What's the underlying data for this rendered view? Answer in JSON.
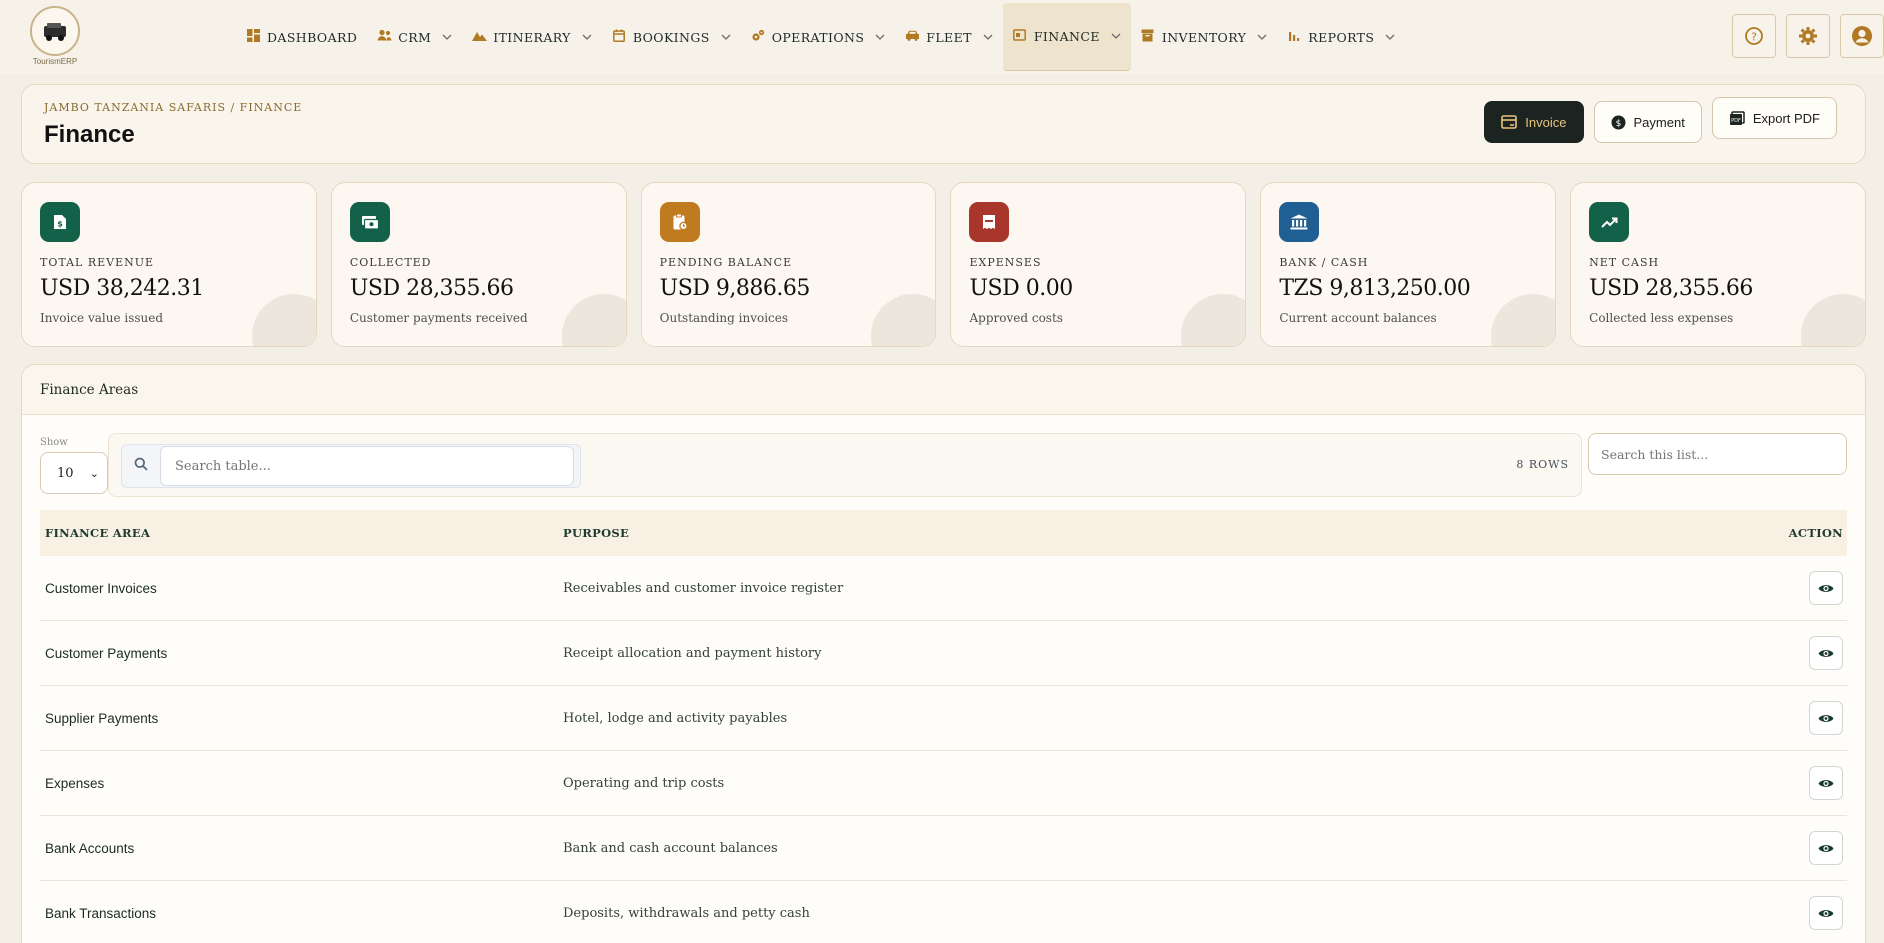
{
  "brand": {
    "name": "TourismERP"
  },
  "nav": [
    {
      "label": "DASHBOARD",
      "icon": "dashboard-icon",
      "dropdown": false,
      "active": false
    },
    {
      "label": "CRM",
      "icon": "users-icon",
      "dropdown": true,
      "active": false
    },
    {
      "label": "ITINERARY",
      "icon": "mountain-icon",
      "dropdown": true,
      "active": false
    },
    {
      "label": "BOOKINGS",
      "icon": "calendar-icon",
      "dropdown": true,
      "active": false
    },
    {
      "label": "OPERATIONS",
      "icon": "gears-icon",
      "dropdown": true,
      "active": false
    },
    {
      "label": "FLEET",
      "icon": "car-icon",
      "dropdown": true,
      "active": false
    },
    {
      "label": "FINANCE",
      "icon": "wallet-icon",
      "dropdown": true,
      "active": true
    },
    {
      "label": "INVENTORY",
      "icon": "archive-icon",
      "dropdown": true,
      "active": false
    },
    {
      "label": "REPORTS",
      "icon": "bar-chart-icon",
      "dropdown": true,
      "active": false
    }
  ],
  "header": {
    "breadcrumb": "JAMBO TANZANIA SAFARIS / FINANCE",
    "title": "Finance",
    "buttons": {
      "invoice": "Invoice",
      "payment": "Payment",
      "export": "Export PDF"
    }
  },
  "stats": [
    {
      "label": "TOTAL REVENUE",
      "value": "USD 38,242.31",
      "sub": "Invoice value issued",
      "icon": "dollar-doc-icon",
      "color": "#14614a"
    },
    {
      "label": "COLLECTED",
      "value": "USD 28,355.66",
      "sub": "Customer payments received",
      "icon": "cash-icon",
      "color": "#14614a"
    },
    {
      "label": "PENDING BALANCE",
      "value": "USD 9,886.65",
      "sub": "Outstanding invoices",
      "icon": "clipboard-clock-icon",
      "color": "#c07a1f"
    },
    {
      "label": "EXPENSES",
      "value": "USD 0.00",
      "sub": "Approved costs",
      "icon": "receipt-icon",
      "color": "#a8362a"
    },
    {
      "label": "BANK / CASH",
      "value": "TZS 9,813,250.00",
      "sub": "Current account balances",
      "icon": "bank-icon",
      "color": "#1f5f93"
    },
    {
      "label": "NET CASH",
      "value": "USD 28,355.66",
      "sub": "Collected less expenses",
      "icon": "trend-up-icon",
      "color": "#14614a"
    }
  ],
  "panel": {
    "title": "Finance Areas",
    "show_label": "Show",
    "show_value": "10",
    "search_placeholder": "Search table...",
    "rows_count": "8 ROWS",
    "list_search_placeholder": "Search this list...",
    "columns": [
      "FINANCE AREA",
      "PURPOSE",
      "ACTION"
    ],
    "rows": [
      {
        "area": "Customer Invoices",
        "purpose": "Receivables and customer invoice register"
      },
      {
        "area": "Customer Payments",
        "purpose": "Receipt allocation and payment history"
      },
      {
        "area": "Supplier Payments",
        "purpose": "Hotel, lodge and activity payables"
      },
      {
        "area": "Expenses",
        "purpose": "Operating and trip costs"
      },
      {
        "area": "Bank Accounts",
        "purpose": "Bank and cash account balances"
      },
      {
        "area": "Bank Transactions",
        "purpose": "Deposits, withdrawals and petty cash"
      }
    ]
  },
  "colors": {
    "accent": "#b07a24",
    "dark": "#1b2420",
    "green": "#14614a"
  }
}
